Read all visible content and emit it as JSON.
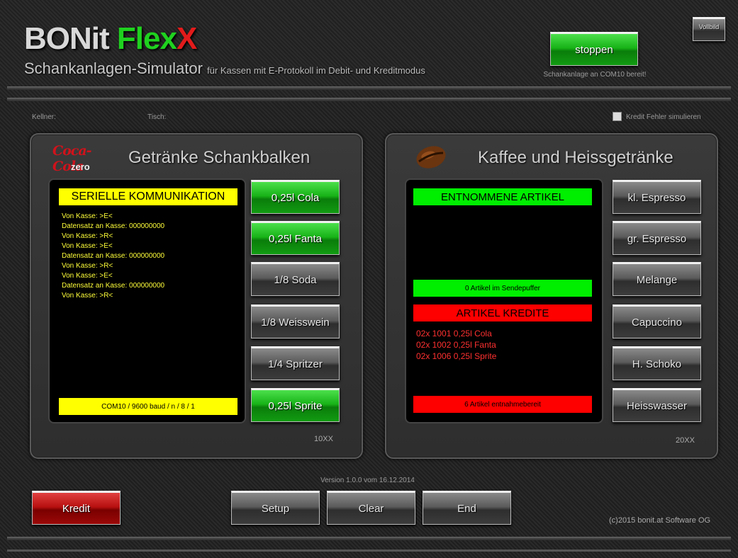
{
  "header": {
    "logo_part1": "BONit ",
    "logo_part2": "Flex",
    "logo_part3": "X",
    "subtitle_main": "Schankanlagen-Simulator",
    "subtitle_small": "für Kassen mit E-Protokoll im Debit- und Kreditmodus",
    "stop_button": "stoppen",
    "status": "Schankanlage an COM10 bereit!",
    "fullscreen_button": "Vollbild"
  },
  "info": {
    "waiter_label": "Kellner:",
    "table_label": "Tisch:",
    "simulate_error_label": "Kredit Fehler simulieren"
  },
  "left_panel": {
    "title": "Getränke Schankbalken",
    "brand_script": "Coca-Cola",
    "brand_sub": "zero",
    "comm_header": "SERIELLE KOMMUNIKATION",
    "log_lines": [
      "Von Kasse: >E<",
      "Datensatz an Kasse: 000000000",
      "Von Kasse: >R<",
      "Von Kasse: >E<",
      "Datensatz an Kasse: 000000000",
      "Von Kasse: >R<",
      "Von Kasse: >E<",
      "Datensatz an Kasse: 000000000",
      "Von Kasse: >R<"
    ],
    "port_settings": "COM10 / 9600 baud / n / 8 / 1",
    "buttons": [
      {
        "label": "0,25l Cola",
        "active": true
      },
      {
        "label": "0,25l Fanta",
        "active": true
      },
      {
        "label": "1/8 Soda",
        "active": false
      },
      {
        "label": "1/8 Weisswein",
        "active": false
      },
      {
        "label": "1/4 Spritzer",
        "active": false
      },
      {
        "label": "0,25l Sprite",
        "active": true
      }
    ],
    "code": "10XX"
  },
  "right_panel": {
    "title": "Kaffee und Heissgetränke",
    "taken_header": "ENTNOMMENE  ARTIKEL",
    "send_buffer": "0 Artikel im Sendepuffer",
    "credit_header": "ARTIKEL KREDITE",
    "credit_lines": [
      "02x 1001 0,25l Cola",
      "02x 1002 0,25l Fanta",
      "02x 1006 0,25l Sprite"
    ],
    "ready_count": "6 Artikel entnahmebereit",
    "buttons": [
      {
        "label": "kl. Espresso"
      },
      {
        "label": "gr. Espresso"
      },
      {
        "label": "Melange"
      },
      {
        "label": "Capuccino"
      },
      {
        "label": "H. Schoko"
      },
      {
        "label": "Heisswasser"
      }
    ],
    "code": "20XX"
  },
  "footer": {
    "version": "Version 1.0.0 vom 16.12.2014",
    "credit_button": "Kredit",
    "setup_button": "Setup",
    "clear_button": "Clear",
    "end_button": "End",
    "copyright": "(c)2015 bonit.at Software OG"
  },
  "colors": {
    "green": "#00ee00",
    "yellow": "#ffff00",
    "red": "#ff0000"
  },
  "icons": {
    "coffee": "coffee-bean-icon",
    "brand": "coca-cola-logo"
  }
}
